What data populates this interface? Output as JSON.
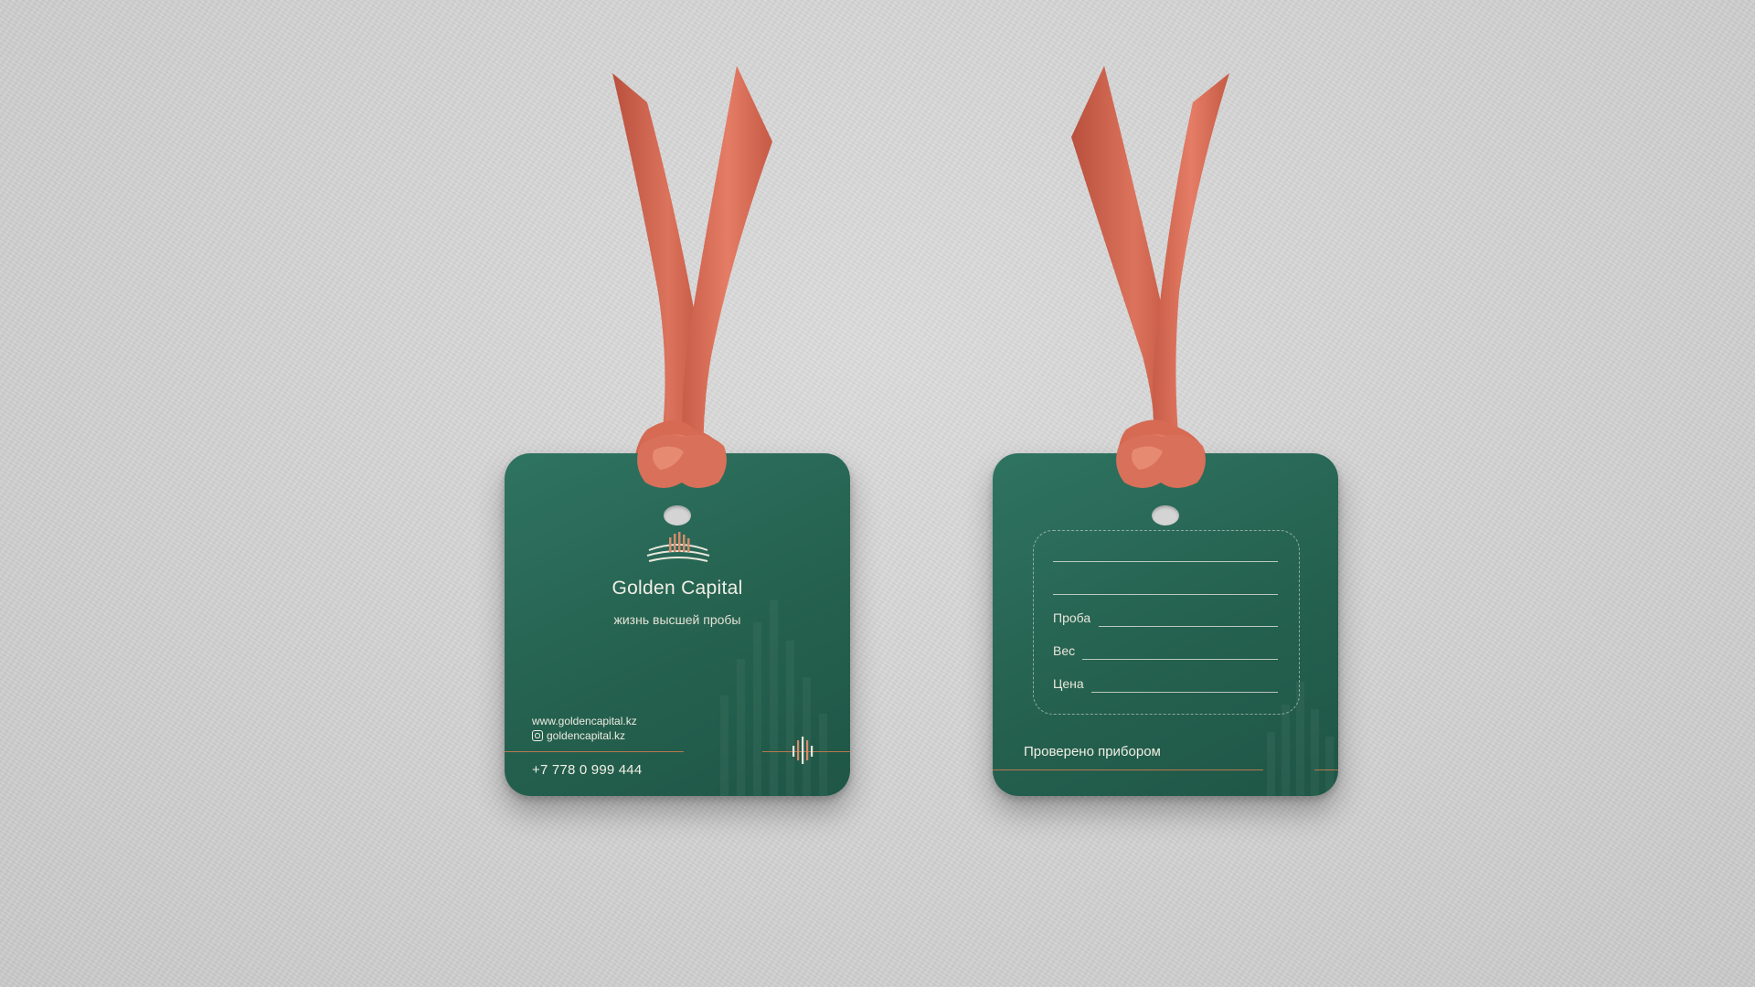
{
  "front_tag": {
    "brand_name": "Golden Capital",
    "slogan": "жизнь высшей пробы",
    "website": "www.goldencapital.kz",
    "instagram": "goldencapital.kz",
    "phone": "+7 778 0 999 444",
    "icons": [
      "brand-logo-icon",
      "instagram-icon",
      "brand-mark-icon"
    ]
  },
  "back_tag": {
    "fields": [
      {
        "label": ""
      },
      {
        "label": ""
      },
      {
        "label": "Проба"
      },
      {
        "label": "Вес"
      },
      {
        "label": "Цена"
      }
    ],
    "footer": "Проверено прибором"
  },
  "colors": {
    "background": "#d2d2d2",
    "tag_green": "#25614f",
    "ribbon_coral": "#d9705a",
    "accent_copper": "#b8784f",
    "text_cream": "#f1efe6"
  }
}
